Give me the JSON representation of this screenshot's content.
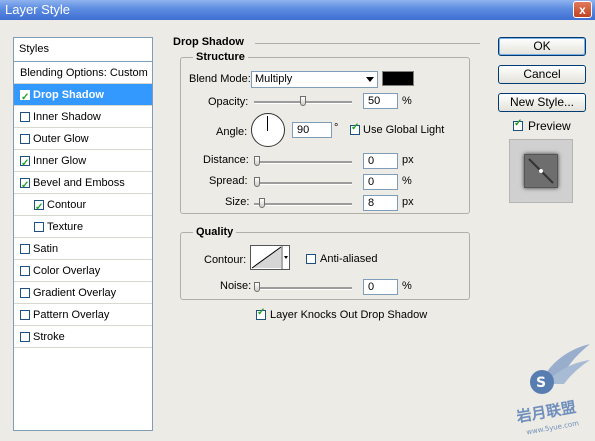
{
  "window": {
    "title": "Layer Style",
    "close_label": "x"
  },
  "styles_panel": {
    "header": "Styles",
    "items": [
      {
        "label": "Blending Options: Custom",
        "checkbox": false,
        "checked": false,
        "selected": false,
        "sub": false
      },
      {
        "label": "Drop Shadow",
        "checkbox": true,
        "checked": true,
        "selected": true,
        "sub": false
      },
      {
        "label": "Inner Shadow",
        "checkbox": true,
        "checked": false,
        "selected": false,
        "sub": false
      },
      {
        "label": "Outer Glow",
        "checkbox": true,
        "checked": false,
        "selected": false,
        "sub": false
      },
      {
        "label": "Inner Glow",
        "checkbox": true,
        "checked": true,
        "selected": false,
        "sub": false
      },
      {
        "label": "Bevel and Emboss",
        "checkbox": true,
        "checked": true,
        "selected": false,
        "sub": false
      },
      {
        "label": "Contour",
        "checkbox": true,
        "checked": true,
        "selected": false,
        "sub": true
      },
      {
        "label": "Texture",
        "checkbox": true,
        "checked": false,
        "selected": false,
        "sub": true
      },
      {
        "label": "Satin",
        "checkbox": true,
        "checked": false,
        "selected": false,
        "sub": false
      },
      {
        "label": "Color Overlay",
        "checkbox": true,
        "checked": false,
        "selected": false,
        "sub": false
      },
      {
        "label": "Gradient Overlay",
        "checkbox": true,
        "checked": false,
        "selected": false,
        "sub": false
      },
      {
        "label": "Pattern Overlay",
        "checkbox": true,
        "checked": false,
        "selected": false,
        "sub": false
      },
      {
        "label": "Stroke",
        "checkbox": true,
        "checked": false,
        "selected": false,
        "sub": false
      }
    ]
  },
  "drop_shadow": {
    "title": "Drop Shadow",
    "structure": {
      "title": "Structure",
      "blend_mode_label": "Blend Mode:",
      "blend_mode_value": "Multiply",
      "shadow_color": "#000000",
      "opacity_label": "Opacity:",
      "opacity_value": "50",
      "opacity_unit": "%",
      "opacity_fraction": 0.5,
      "angle_label": "Angle:",
      "angle_value": "90",
      "angle_unit": "°",
      "use_global_light_label": "Use Global Light",
      "use_global_light": true,
      "distance_label": "Distance:",
      "distance_value": "0",
      "distance_unit": "px",
      "spread_label": "Spread:",
      "spread_value": "0",
      "spread_unit": "%",
      "size_label": "Size:",
      "size_value": "8",
      "size_unit": "px"
    },
    "quality": {
      "title": "Quality",
      "contour_label": "Contour:",
      "anti_aliased_label": "Anti-aliased",
      "anti_aliased": false,
      "noise_label": "Noise:",
      "noise_value": "0",
      "noise_unit": "%"
    },
    "knockout_label": "Layer Knocks Out Drop Shadow",
    "knockout": true
  },
  "buttons": {
    "ok": "OK",
    "cancel": "Cancel",
    "new_style": "New Style...",
    "preview_label": "Preview",
    "preview_checked": true
  },
  "watermark": {
    "text": "岩月联盟",
    "domain": "www.5yue.com"
  }
}
